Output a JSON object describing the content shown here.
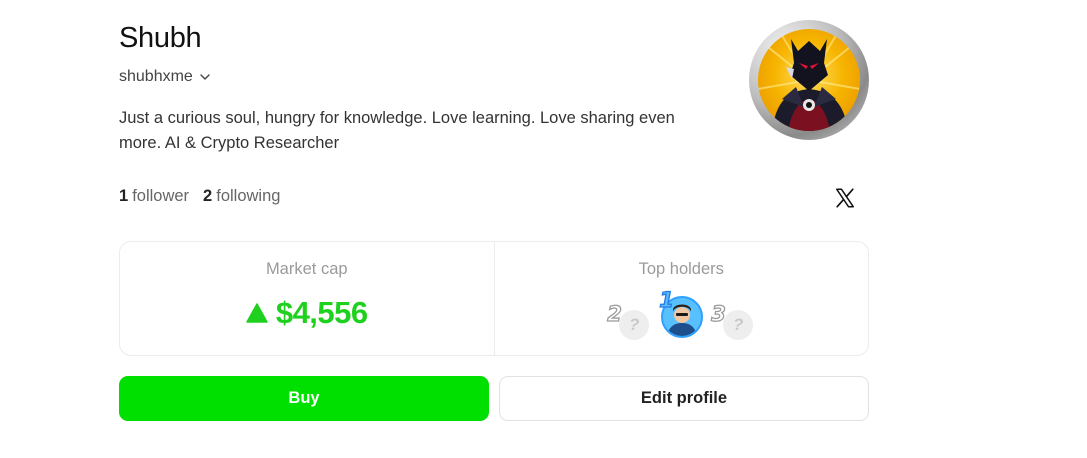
{
  "profile": {
    "name": "Shubh",
    "handle": "shubhxme",
    "bio": "Just a curious soul, hungry for knowledge. Love learning. Love sharing even more. AI & Crypto Researcher",
    "followers_count": "1",
    "followers_label": "follower",
    "following_count": "2",
    "following_label": "following",
    "avatar_icon": "anime-villain-avatar",
    "social_icon": "x-logo-icon"
  },
  "stats": {
    "market_cap_label": "Market cap",
    "market_cap_value": "$4,556",
    "market_cap_trend": "up",
    "top_holders_label": "Top holders",
    "holders": [
      {
        "rank": "2",
        "placeholder": "?"
      },
      {
        "rank": "1",
        "avatar_icon": "holder-avatar"
      },
      {
        "rank": "3",
        "placeholder": "?"
      }
    ]
  },
  "actions": {
    "buy_label": "Buy",
    "edit_label": "Edit profile"
  },
  "colors": {
    "accent_green": "#00e000",
    "price_green": "#1fd11f",
    "muted_text": "#9a9a9a",
    "border": "#ececec"
  }
}
